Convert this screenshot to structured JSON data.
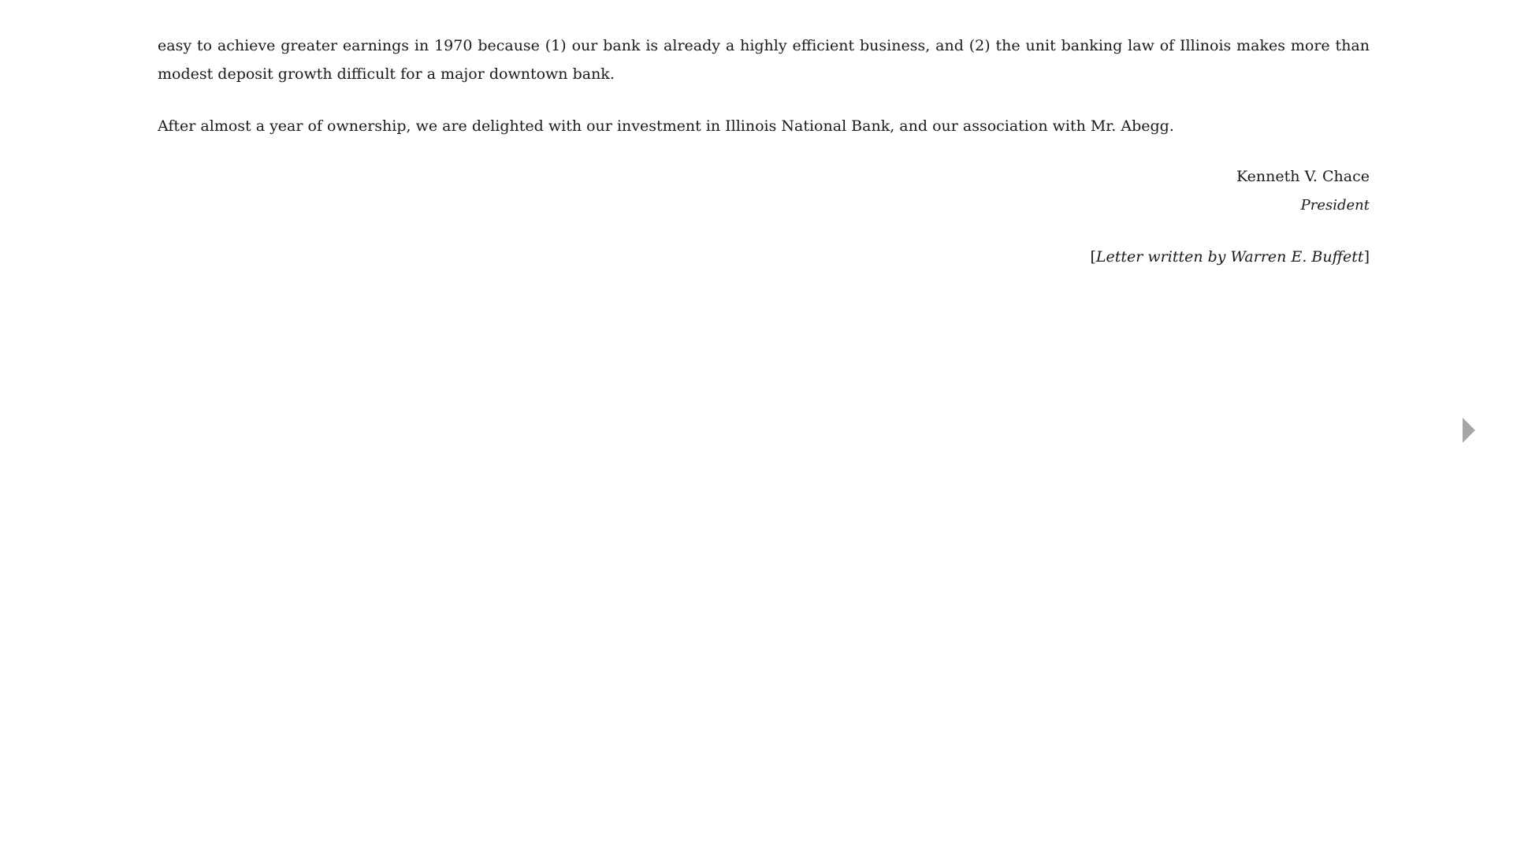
{
  "reader": {
    "paragraphs": [
      "easy to achieve greater earnings in 1970 because (1) our bank is already a highly efficient business, and (2) the unit banking law of Illinois makes more than modest deposit growth difficult for a major downtown bank.",
      "After almost a year of ownership, we are delighted with our investment in Illinois National Bank, and our association with Mr. Abegg."
    ],
    "signature": {
      "name": "Kenneth V. Chace",
      "title": "President"
    },
    "attribution": {
      "open_bracket": "[",
      "text": "Letter written by Warren E. Buffett",
      "close_bracket": "]"
    }
  },
  "navigation": {
    "next_icon": "chevron-right-icon",
    "icon_color": "#a6a6a6"
  }
}
